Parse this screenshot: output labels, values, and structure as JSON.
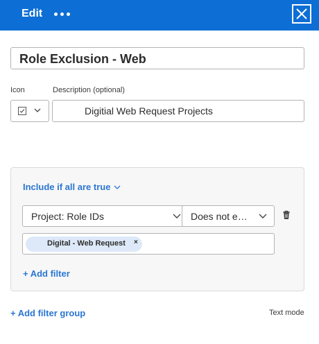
{
  "header": {
    "title": "Edit",
    "more_icon": "more-horizontal-icon",
    "close_icon": "close-icon",
    "background": "#0d6ed5"
  },
  "form": {
    "name_value": "Role Exclusion - Web",
    "icon_label": "Icon",
    "icon_value": "checkbox-icon",
    "description_label": "Description (optional)",
    "description_value": "Digitial Web Request Projects"
  },
  "filter_group": {
    "include_label": "Include if all are true",
    "filter": {
      "field": "Project: Role IDs",
      "operator": "Does not e…",
      "values": [
        "Digital - Web Request"
      ]
    },
    "add_filter_label": "+ Add filter"
  },
  "footer": {
    "add_filter_group_label": "+ Add filter group",
    "text_mode_label": "Text mode"
  },
  "colors": {
    "accent": "#2a76d2",
    "tag_background": "#dde9f8"
  }
}
